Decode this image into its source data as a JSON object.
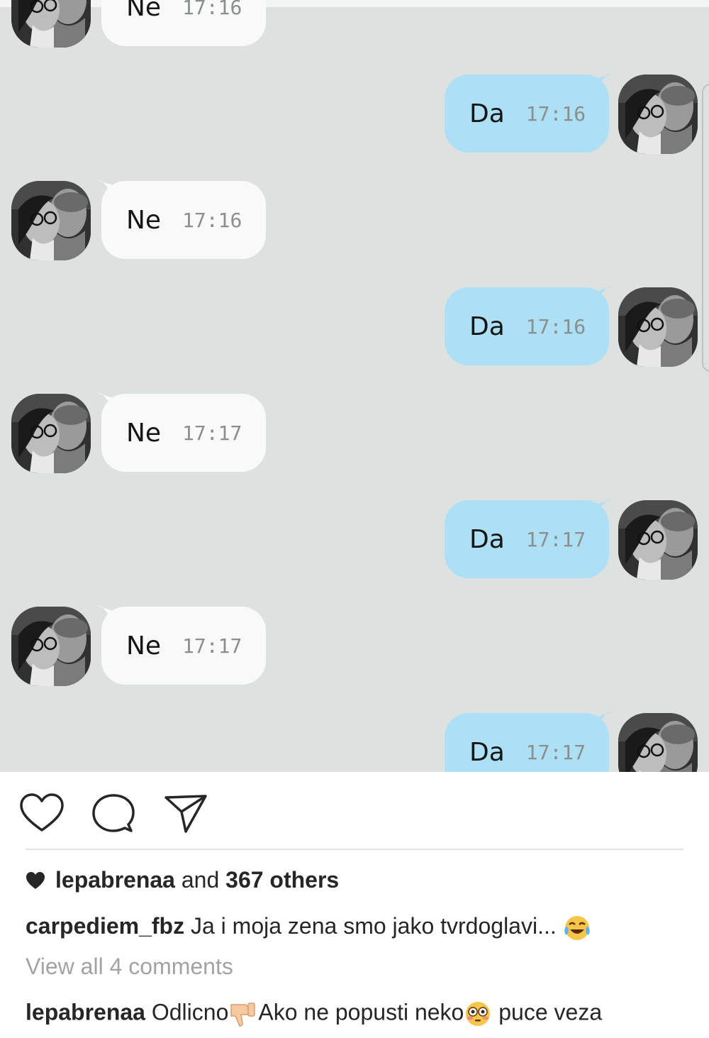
{
  "chat": {
    "messages": [
      {
        "side": "in",
        "text": "Ne",
        "time": "17:16"
      },
      {
        "side": "out",
        "text": "Da",
        "time": "17:16"
      },
      {
        "side": "in",
        "text": "Ne",
        "time": "17:16"
      },
      {
        "side": "out",
        "text": "Da",
        "time": "17:16"
      },
      {
        "side": "in",
        "text": "Ne",
        "time": "17:17"
      },
      {
        "side": "out",
        "text": "Da",
        "time": "17:17"
      },
      {
        "side": "in",
        "text": "Ne",
        "time": "17:17"
      },
      {
        "side": "out",
        "text": "Da",
        "time": "17:17"
      }
    ],
    "colors": {
      "background": "#dde1df",
      "incoming_bubble": "#f9f9f9",
      "outgoing_bubble": "#ade0f5"
    }
  },
  "actions": {
    "icons": [
      "heart-icon",
      "comment-icon",
      "share-icon"
    ]
  },
  "likes": {
    "user": "lepabrenaa",
    "connector": "and",
    "count_text": "367 others"
  },
  "caption": {
    "user": "carpediem_fbz",
    "text": "Ja i moja zena smo jako tvrdoglavi...",
    "emoji": "face-with-tears-of-joy"
  },
  "view_all": "View all 4 comments",
  "comment": {
    "user": "lepabrenaa",
    "part1": "Odlicno",
    "emoji1": "thumbs-down",
    "part2": "Ako ne popusti neko",
    "emoji2": "flushed-face",
    "part3": "puce veza"
  }
}
